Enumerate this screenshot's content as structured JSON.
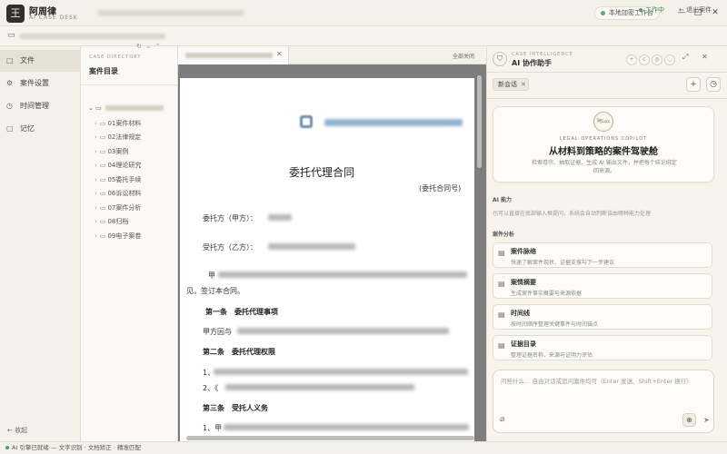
{
  "app": {
    "name": "阿周律",
    "subtitle": "AI CASE DESK",
    "logo_glyph": "王",
    "sync_label": "本地加密工作台"
  },
  "window": {
    "min": "—",
    "max": "□",
    "close": "✕"
  },
  "pathbar": {
    "status": "工作中",
    "exit": "← 退出案件"
  },
  "nav": {
    "items": [
      {
        "label": "文件",
        "icon": "□"
      },
      {
        "label": "案件设置",
        "icon": "⚙"
      },
      {
        "label": "时间管理",
        "icon": "◷"
      },
      {
        "label": "记忆",
        "icon": "▢"
      }
    ],
    "collapse": "← 收起"
  },
  "directory": {
    "caption": "CASE DIRECTORY",
    "title": "案件目录",
    "folders": [
      "01案件材料",
      "02法律规定",
      "03案例",
      "04理论研究",
      "05委托手续",
      "06诉讼材料",
      "07案件分析",
      "08归档",
      "09电子案卷"
    ]
  },
  "doc": {
    "close_all": "全部关闭",
    "title": "委托代理合同",
    "number": "(委托合同号)",
    "client_label": "委托方（甲方）：",
    "agent_label": "受托方（乙方）：",
    "para_start": "甲",
    "para_end": "见，签订本合同。",
    "art1": "第一条　委托代理事项",
    "art1_line": "甲方因与",
    "art2": "第二条　委托代理权限",
    "art2_l1": "1、",
    "art2_l2": "2、《",
    "art3": "第三条　受托人义务",
    "art3_l1": "1、甲"
  },
  "ai": {
    "caption": "CASE INTELLIGENCE",
    "title": "AI 协作助手",
    "session": "新会话",
    "hero": {
      "badge": "阿Lex",
      "caption": "LEGAL OPERATIONS COPILOT",
      "title": "从材料到策略的案件驾驶舱",
      "desc": "检索卷宗、抽取证据、生成 AI 输出文件，并把每个结论绑定回来源。"
    },
    "capability_label": "AI 能力",
    "capability_desc": "也可以直接在底部输入框提问，系统会自动判断该由哪种能力处理",
    "analysis_label": "案件分析",
    "features": [
      {
        "title": "案件脉络",
        "desc": "快速了解案件现状、证据支撑与下一步建议"
      },
      {
        "title": "案情摘要",
        "desc": "生成案件事实概要与来源依据"
      },
      {
        "title": "时间线",
        "desc": "按时间顺序整理关键事件与时间锚点"
      },
      {
        "title": "证据目录",
        "desc": "整理证据名称、来源与证明力评估"
      }
    ],
    "input_placeholder": "问些什么… 自由对话或追问案件均可（Enter 发送、Shift+Enter 换行）"
  },
  "status": {
    "text": "AI 引擎已就绪",
    "extra": " —  文字识别 · 文档矫正 · 精准匹配"
  }
}
